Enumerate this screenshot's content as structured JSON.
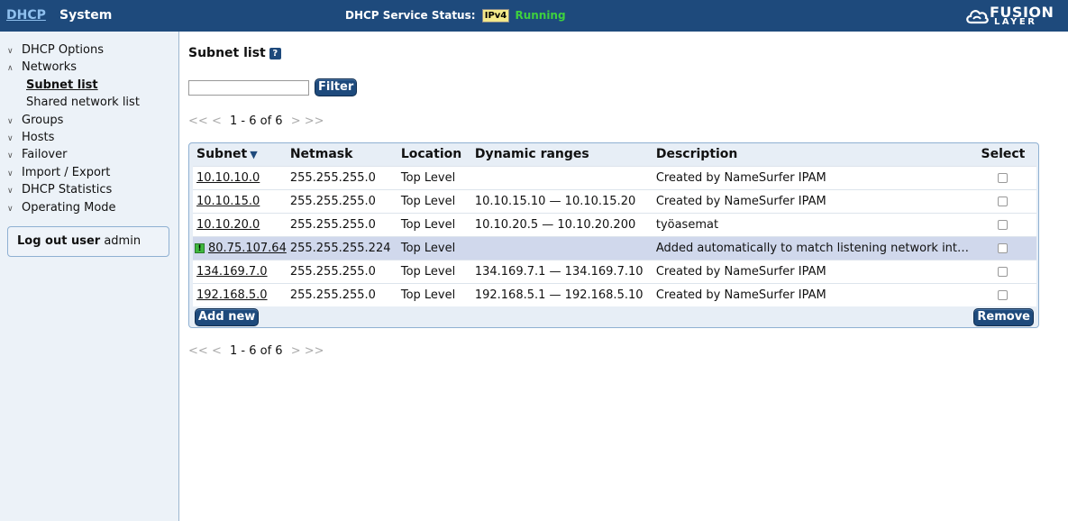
{
  "header": {
    "nav_dhcp": "DHCP",
    "nav_system": "System",
    "status_label": "DHCP Service Status:",
    "ipv4_badge": "IPv4",
    "status_value": "Running",
    "logo_line1": "FUSION",
    "logo_line2": "LAYER",
    "colors": {
      "bar": "#1e4a7c",
      "running": "#3ed13e"
    }
  },
  "sidebar": {
    "items": [
      {
        "label": "DHCP Options",
        "icon": "chevron-down-icon"
      },
      {
        "label": "Networks",
        "icon": "chevron-up-icon"
      },
      {
        "label": "Subnet list",
        "sub": true,
        "active": true
      },
      {
        "label": "Shared network list",
        "sub": true
      },
      {
        "label": "Groups",
        "icon": "chevron-down-icon"
      },
      {
        "label": "Hosts",
        "icon": "chevron-down-icon"
      },
      {
        "label": "Failover",
        "icon": "chevron-down-icon"
      },
      {
        "label": "Import / Export",
        "icon": "chevron-down-icon"
      },
      {
        "label": "DHCP Statistics",
        "icon": "chevron-down-icon"
      },
      {
        "label": "Operating Mode",
        "icon": "chevron-down-icon"
      }
    ],
    "logout_label": "Log out user",
    "logout_user": "admin"
  },
  "main": {
    "title": "Subnet list",
    "help": "?",
    "filter_value": "",
    "filter_button": "Filter",
    "pager": {
      "first": "<<",
      "prev": "<",
      "range": "1 - 6 of 6",
      "next": ">",
      "last": ">>"
    },
    "columns": [
      "Subnet",
      "Netmask",
      "Location",
      "Dynamic ranges",
      "Description",
      "Select"
    ],
    "rows": [
      {
        "subnet": "10.10.10.0",
        "netmask": "255.255.255.0",
        "location": "Top Level",
        "dynamic": "",
        "description": "Created by NameSurfer IPAM"
      },
      {
        "subnet": "10.10.15.0",
        "netmask": "255.255.255.0",
        "location": "Top Level",
        "dynamic": "10.10.15.10 — 10.10.15.20",
        "description": "Created by NameSurfer IPAM"
      },
      {
        "subnet": "10.10.20.0",
        "netmask": "255.255.255.0",
        "location": "Top Level",
        "dynamic": "10.10.20.5 — 10.10.20.200",
        "description": "työasemat"
      },
      {
        "subnet": "80.75.107.64",
        "netmask": "255.255.255.224",
        "location": "Top Level",
        "dynamic": "",
        "description": "Added automatically to match listening network int…",
        "warning": true
      },
      {
        "subnet": "134.169.7.0",
        "netmask": "255.255.255.0",
        "location": "Top Level",
        "dynamic": "134.169.7.1 — 134.169.7.10",
        "description": "Created by NameSurfer IPAM"
      },
      {
        "subnet": "192.168.5.0",
        "netmask": "255.255.255.0",
        "location": "Top Level",
        "dynamic": "192.168.5.1 — 192.168.5.10",
        "description": "Created by NameSurfer IPAM"
      }
    ],
    "add_button": "Add new",
    "remove_button": "Remove",
    "warning_glyph": "!"
  }
}
